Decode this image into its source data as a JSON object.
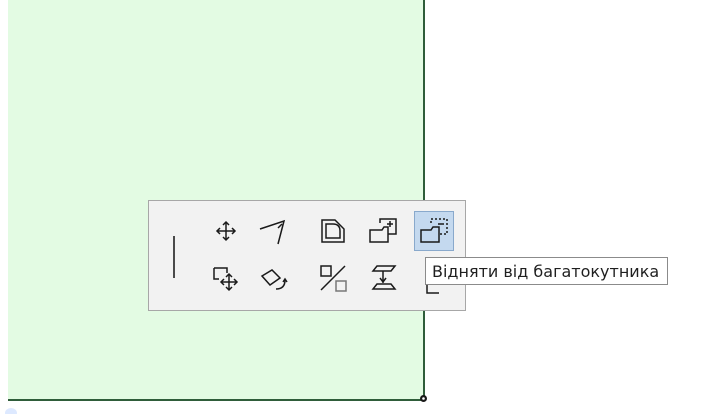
{
  "tooltip": {
    "text": "Відняти від багатокутника"
  },
  "palette": {
    "tools": [
      {
        "icon": "move-icon"
      },
      {
        "icon": "angle-icon"
      },
      {
        "icon": "rounded-shape-icon"
      },
      {
        "icon": "add-to-polygon-icon"
      },
      {
        "icon": "subtract-from-polygon-icon",
        "active": true
      },
      {
        "icon": "drag-offset-icon"
      },
      {
        "icon": "rotate-polygon-icon"
      },
      {
        "icon": "mirror-icon"
      },
      {
        "icon": "elevate-icon"
      },
      {
        "icon": "partial-polygon-icon"
      }
    ]
  },
  "colors": {
    "zone_fill": "#e3fbe3",
    "zone_border": "#2f5d3a",
    "active_tool": "#c4d9ef"
  }
}
